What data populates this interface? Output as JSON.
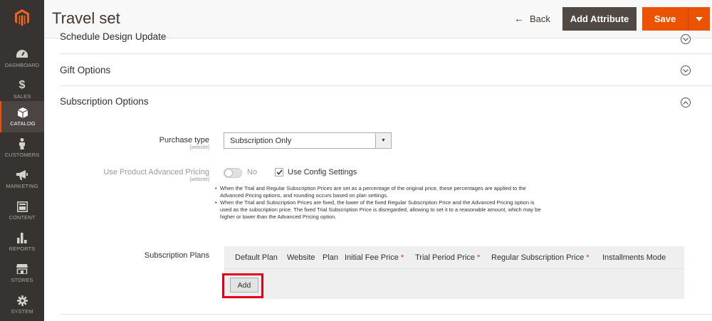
{
  "sidebar": {
    "items": [
      {
        "label": "DASHBOARD",
        "icon": "dashboard-icon"
      },
      {
        "label": "SALES",
        "icon": "dollar-icon"
      },
      {
        "label": "CATALOG",
        "icon": "cube-icon"
      },
      {
        "label": "CUSTOMERS",
        "icon": "person-icon"
      },
      {
        "label": "MARKETING",
        "icon": "megaphone-icon"
      },
      {
        "label": "CONTENT",
        "icon": "layout-icon"
      },
      {
        "label": "REPORTS",
        "icon": "bar-chart-icon"
      },
      {
        "label": "STORES",
        "icon": "storefront-icon"
      },
      {
        "label": "SYSTEM",
        "icon": "gear-icon"
      }
    ],
    "active": "CATALOG",
    "accent_color": "#eb5202"
  },
  "header": {
    "title": "Travel set",
    "back_label": "Back",
    "add_attribute_label": "Add Attribute",
    "save_label": "Save"
  },
  "sections": {
    "design_update": "Schedule Design Update",
    "gift_options": "Gift Options",
    "subscription_options": "Subscription Options"
  },
  "form": {
    "purchase_type": {
      "label": "Purchase type",
      "scope": "[website]",
      "value": "Subscription Only"
    },
    "advanced_pricing": {
      "label": "Use Product Advanced Pricing",
      "scope": "[website]",
      "switch_label": "No",
      "config_label": "Use Config Settings",
      "config_checked": true
    },
    "notes": [
      "When the Trial and Regular Subscription Prices are set as a percentage of the original price, these percentages are applied to the Advanced Pricing options, and rounding occurs based on plan settings.",
      "When the Trial and Subscription Prices are fixed, the lower of the fixed Regular Subscription Price and the Advanced Pricing option is used as the subscription price. The fixed Trial Subscription Price is disregarded, allowing to set it to a reasonable amount, which may be higher or lower than the Advanced Pricing option."
    ],
    "plans": {
      "label": "Subscription Plans",
      "columns": [
        {
          "label": "Default Plan",
          "required": false
        },
        {
          "label": "Website",
          "required": false
        },
        {
          "label": "Plan",
          "required": false
        },
        {
          "label": "Initial Fee Price",
          "required": true
        },
        {
          "label": "Trial Period Price",
          "required": true
        },
        {
          "label": "Regular Subscription Price",
          "required": true
        },
        {
          "label": "Installments Mode",
          "required": false
        }
      ],
      "required_mark": "*",
      "add_label": "Add"
    }
  }
}
